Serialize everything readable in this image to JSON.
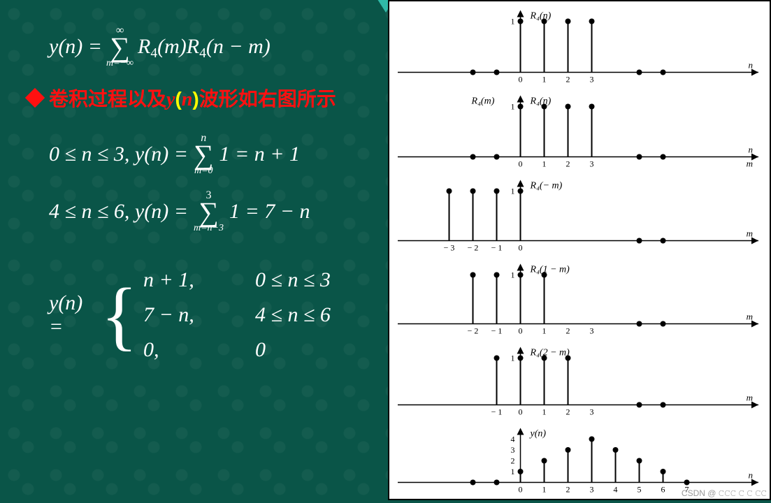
{
  "equations": {
    "main_lhs": "y(n) = ",
    "sigma1_top": "∞",
    "sigma1_bot": "m=−∞",
    "sigma1_body_1": "R",
    "sigma1_body_1s": "4",
    "sigma1_body_2": "(m)R",
    "sigma1_body_2s": "4",
    "sigma1_body_3": "(n − m)",
    "case_a_cond": "0 ≤ n ≤ 3,  y(n) = ",
    "case_a_sigtop": "n",
    "case_a_sigbot": "m=0",
    "case_a_rhs": "1 = n + 1",
    "case_b_cond": "4 ≤ n ≤ 6,  y(n) = ",
    "case_b_sigtop": "3",
    "case_b_sigbot": "m=n−3",
    "case_b_rhs": "1 = 7 − n",
    "piecewise_lhs": "y(n) = ",
    "pw_r1c1": "n + 1,",
    "pw_r1c2": "0 ≤ n ≤ 3",
    "pw_r2c1": "7 − n,",
    "pw_r2c2": "4 ≤ n ≤ 6",
    "pw_r3c1": "0,",
    "pw_r3c2": "0"
  },
  "headline": {
    "pre": "卷积过程以及",
    "yn_y": "y",
    "yn_lp": "(",
    "yn_n": "n",
    "yn_rp": ")",
    "post": "波形如右图所示"
  },
  "chart_data": [
    {
      "type": "stem",
      "title": "R₄(n)",
      "xlabel": "n",
      "xticks": [
        0,
        1,
        2,
        3
      ],
      "yticks": [
        1
      ],
      "points": [
        {
          "x": -2,
          "y": 0
        },
        {
          "x": -1,
          "y": 0
        },
        {
          "x": 0,
          "y": 1
        },
        {
          "x": 1,
          "y": 1
        },
        {
          "x": 2,
          "y": 1
        },
        {
          "x": 3,
          "y": 1
        },
        {
          "x": 5,
          "y": 0
        },
        {
          "x": 6,
          "y": 0
        }
      ]
    },
    {
      "type": "stem",
      "title_left": "R₄(m)",
      "title": "R₄(n)",
      "xlabel": "n",
      "xlabel2": "m",
      "xticks": [
        0,
        1,
        2,
        3
      ],
      "yticks": [
        1
      ],
      "points": [
        {
          "x": -2,
          "y": 0
        },
        {
          "x": -1,
          "y": 0
        },
        {
          "x": 0,
          "y": 1
        },
        {
          "x": 1,
          "y": 1
        },
        {
          "x": 2,
          "y": 1
        },
        {
          "x": 3,
          "y": 1
        },
        {
          "x": 5,
          "y": 0
        },
        {
          "x": 6,
          "y": 0
        }
      ]
    },
    {
      "type": "stem",
      "title": "R₄(− m)",
      "xlabel": "m",
      "xticks_labels": [
        "− 3",
        "− 2",
        "− 1",
        "0"
      ],
      "xticks": [
        -3,
        -2,
        -1,
        0
      ],
      "yticks": [
        1
      ],
      "points": [
        {
          "x": -3,
          "y": 1
        },
        {
          "x": -2,
          "y": 1
        },
        {
          "x": -1,
          "y": 1
        },
        {
          "x": 0,
          "y": 1
        },
        {
          "x": 5,
          "y": 0
        },
        {
          "x": 6,
          "y": 0
        }
      ]
    },
    {
      "type": "stem",
      "title": "R₄(1 − m)",
      "xlabel": "m",
      "xticks_labels": [
        "− 2",
        "− 1",
        "0",
        "1",
        "2",
        "3"
      ],
      "xticks": [
        -2,
        -1,
        0,
        1,
        2,
        3
      ],
      "yticks": [
        1
      ],
      "points": [
        {
          "x": -2,
          "y": 1
        },
        {
          "x": -1,
          "y": 1
        },
        {
          "x": 0,
          "y": 1
        },
        {
          "x": 1,
          "y": 1
        },
        {
          "x": 5,
          "y": 0
        },
        {
          "x": 6,
          "y": 0
        }
      ]
    },
    {
      "type": "stem",
      "title": "R₄(2 − m)",
      "xlabel": "m",
      "xticks_labels": [
        "− 1",
        "0",
        "1",
        "2",
        "3"
      ],
      "xticks": [
        -1,
        0,
        1,
        2,
        3
      ],
      "yticks": [
        1
      ],
      "points": [
        {
          "x": -1,
          "y": 1
        },
        {
          "x": 0,
          "y": 1
        },
        {
          "x": 1,
          "y": 1
        },
        {
          "x": 2,
          "y": 1
        },
        {
          "x": 5,
          "y": 0
        },
        {
          "x": 6,
          "y": 0
        }
      ]
    },
    {
      "type": "stem",
      "title": "y(n)",
      "xlabel": "n",
      "xticks": [
        0,
        1,
        2,
        3,
        4,
        5,
        6,
        7
      ],
      "yticks": [
        1,
        2,
        3,
        4
      ],
      "ymax": 4,
      "points": [
        {
          "x": -2,
          "y": 0
        },
        {
          "x": -1,
          "y": 0
        },
        {
          "x": 0,
          "y": 1
        },
        {
          "x": 1,
          "y": 2
        },
        {
          "x": 2,
          "y": 3
        },
        {
          "x": 3,
          "y": 4
        },
        {
          "x": 4,
          "y": 3
        },
        {
          "x": 5,
          "y": 2
        },
        {
          "x": 6,
          "y": 1
        },
        {
          "x": 7,
          "y": 0
        }
      ]
    }
  ],
  "watermark": "CSDN @ 𝙲𝙲𝙲 𝙲 𝙲 𝙲𝙲"
}
